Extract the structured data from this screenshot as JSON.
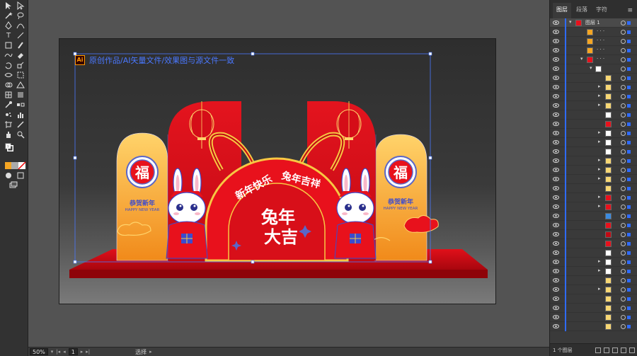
{
  "canvas": {
    "artboard_note": "原创作品/AI矢量文件/效果图与源文件一致",
    "ai_badge": "Ai"
  },
  "design": {
    "main_title_line1": "兔年",
    "main_title_line2": "大吉",
    "arc_text_left": "新年快乐",
    "arc_text_right": "兔年吉祥",
    "fu_char": "福",
    "greeting_cn": "恭贺新年",
    "greeting_en": "HAPPY NEW YEAR"
  },
  "panel": {
    "tabs": [
      "图层",
      "段落",
      "字符"
    ],
    "menu_icon": "menu-icon",
    "layer_name": "图层 1",
    "sub_dots": "· · ·",
    "footer_label": "1 个图层"
  },
  "statusbar": {
    "zoom": "50%",
    "page": "1",
    "tool_label": "选择"
  },
  "colors": {
    "selection": "#4a78ff",
    "red": "#d8101c",
    "orange": "#f5a623",
    "gold": "#f7d774"
  }
}
